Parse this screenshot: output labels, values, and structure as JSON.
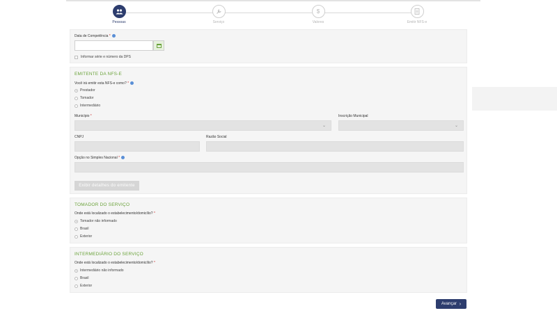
{
  "stepper": {
    "steps": [
      {
        "label": "Pessoas",
        "icon": "people-icon"
      },
      {
        "label": "Serviço",
        "icon": "wrench-icon"
      },
      {
        "label": "Valores",
        "icon": "dollar-icon"
      },
      {
        "label": "Emitir NFS-e",
        "icon": "document-icon"
      }
    ],
    "active_index": 0
  },
  "competencia": {
    "date_label": "Data de Competência",
    "date_value": "",
    "checkbox_label": "Informar série e número da DPS"
  },
  "emitente": {
    "title": "EMITENTE DA NFS-E",
    "question": "Você irá emitir esta NFS-e como?",
    "options": [
      "Prestador",
      "Tomador",
      "Intermediário"
    ],
    "selected": "Prestador",
    "municipio_label": "Município",
    "inscricao_label": "Inscrição Municipal",
    "cnpj_label": "CNPJ",
    "razao_label": "Razão Social",
    "simples_label": "Opção no Simples Nacional",
    "details_button": "Exibir detalhes do emitente"
  },
  "tomador": {
    "title": "TOMADOR DO SERVIÇO",
    "question": "Onde está localizado o estabelecimento/domicílio?",
    "options": [
      "Tomador não informado",
      "Brasil",
      "Exterior"
    ],
    "selected": "Tomador não informado"
  },
  "intermediario": {
    "title": "INTERMEDIÁRIO DO SERVIÇO",
    "question": "Onde está localizado o estabelecimento/domicílio?",
    "options": [
      "Intermediário não informado",
      "Brasil",
      "Exterior"
    ],
    "selected": "Intermediário não informado"
  },
  "footer": {
    "next_label": "Avançar"
  },
  "colors": {
    "primary": "#2d3d6e",
    "section_title": "#6aa23a",
    "calendar_button": "#e6f1dd"
  }
}
